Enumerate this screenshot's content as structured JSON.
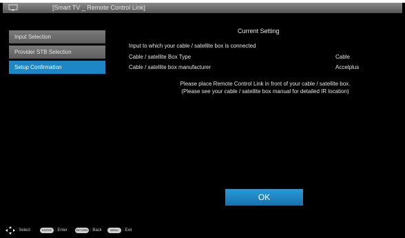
{
  "window": {
    "title": "[Smart TV _ Remote Control Link]"
  },
  "menu": {
    "items": [
      {
        "label": "Input Selection"
      },
      {
        "label": "Provider STB Selection"
      },
      {
        "label": "Setup Confirmation"
      }
    ]
  },
  "content": {
    "heading": "Current Setting",
    "rows": [
      {
        "label": "Input to which your cable / satellite box is connected",
        "value": ""
      },
      {
        "label": "Cable / satellite Box Type",
        "value": "Cable"
      },
      {
        "label": "Cable / satellite box manufacturer",
        "value": "Accelplus"
      }
    ],
    "note_lines": [
      "Please place Remote Control Link in front of your cable / satellite box.",
      "(Please see your cable / satellite box manual for detailed IR location)"
    ],
    "ok_label": "OK"
  },
  "footer": {
    "select": ": Select",
    "enter_key": "ENTER",
    "enter": ": Enter",
    "back_key": "RETURN",
    "back": ": Back",
    "exit_key": "MENU",
    "exit": ": Exit"
  },
  "colors": {
    "background": "#000000",
    "accent": "#1d86c4",
    "menu_inactive": "#6a6a6a"
  },
  "icons": [
    "tv-icon",
    "dpad-icon"
  ]
}
